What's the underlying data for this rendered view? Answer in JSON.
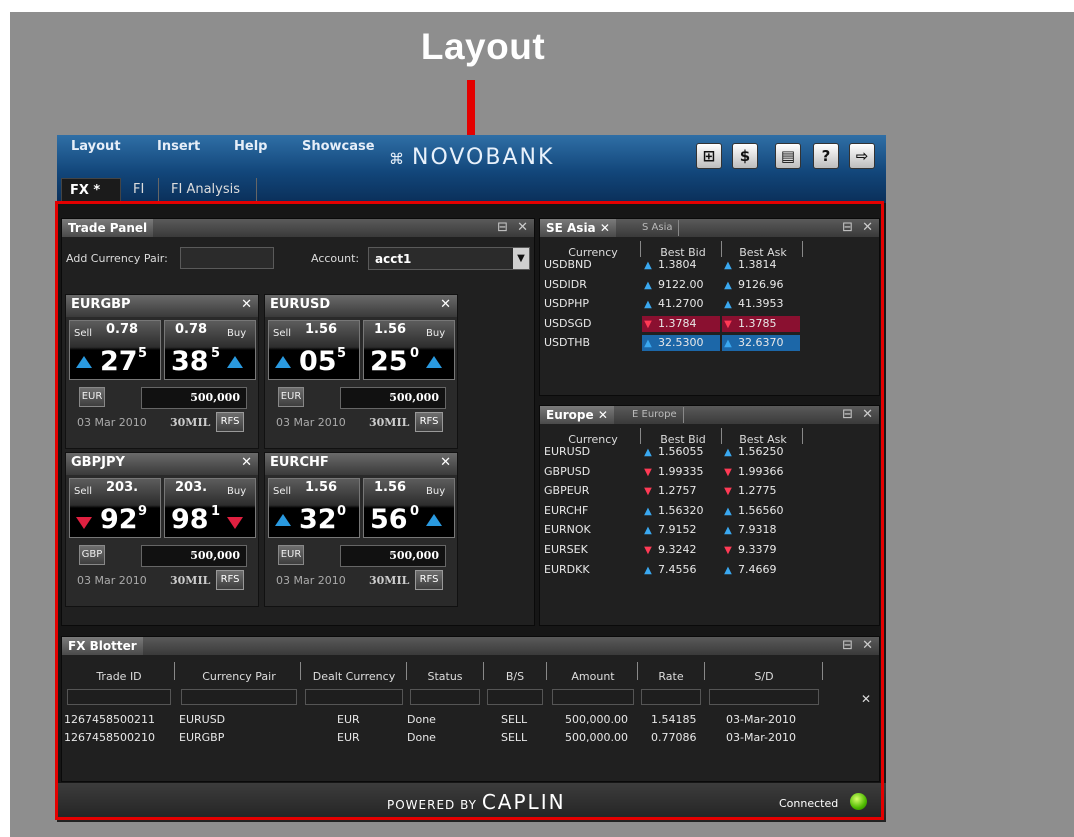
{
  "caption": "Layout",
  "menu": {
    "items": [
      "Layout",
      "Insert",
      "Help",
      "Showcase"
    ]
  },
  "brand": {
    "glyph": "⌘",
    "name": "NOVOBANK"
  },
  "toolbar": {
    "buttons": [
      {
        "icon": "add-panel-icon",
        "glyph": "⊞"
      },
      {
        "icon": "add-currency-icon",
        "glyph": "$"
      },
      {
        "icon": "save-icon",
        "glyph": "▤"
      },
      {
        "icon": "help-icon",
        "glyph": "?"
      },
      {
        "icon": "logout-icon",
        "glyph": "⇨"
      }
    ]
  },
  "tabs": [
    {
      "label": "FX *",
      "active": true
    },
    {
      "label": "FI",
      "active": false
    },
    {
      "label": "FI Analysis",
      "active": false
    }
  ],
  "trade_panel": {
    "title": "Trade Panel",
    "add_pair_label": "Add Currency Pair:",
    "add_pair_value": "",
    "account_label": "Account:",
    "account_value": "acct1",
    "tiles": [
      {
        "pair": "EURGBP",
        "sell_label": "Sell",
        "buy_label": "Buy",
        "sell_big": "0.78",
        "buy_big": "0.78",
        "sell_pips": "27",
        "sell_sup": "5",
        "buy_pips": "38",
        "buy_sup": "5",
        "dir": "up",
        "currency": "EUR",
        "amount": "500,000",
        "date": "03 Mar 2010",
        "tenor": "30MIL",
        "rfs": "RFS"
      },
      {
        "pair": "EURUSD",
        "sell_label": "Sell",
        "buy_label": "Buy",
        "sell_big": "1.56",
        "buy_big": "1.56",
        "sell_pips": "05",
        "sell_sup": "5",
        "buy_pips": "25",
        "buy_sup": "0",
        "dir": "up",
        "currency": "EUR",
        "amount": "500,000",
        "date": "03 Mar 2010",
        "tenor": "30MIL",
        "rfs": "RFS"
      },
      {
        "pair": "GBPJPY",
        "sell_label": "Sell",
        "buy_label": "Buy",
        "sell_big": "203.",
        "buy_big": "203.",
        "sell_pips": "92",
        "sell_sup": "9",
        "buy_pips": "98",
        "buy_sup": "1",
        "dir": "down",
        "currency": "GBP",
        "amount": "500,000",
        "date": "03 Mar 2010",
        "tenor": "30MIL",
        "rfs": "RFS"
      },
      {
        "pair": "EURCHF",
        "sell_label": "Sell",
        "buy_label": "Buy",
        "sell_big": "1.56",
        "buy_big": "1.56",
        "sell_pips": "32",
        "sell_sup": "0",
        "buy_pips": "56",
        "buy_sup": "0",
        "dir": "up",
        "currency": "EUR",
        "amount": "500,000",
        "date": "03 Mar 2010",
        "tenor": "30MIL",
        "rfs": "RFS"
      }
    ]
  },
  "se_asia": {
    "title": "SE Asia",
    "tab2": "S Asia",
    "columns": [
      "Currency",
      "Best Bid",
      "Best Ask"
    ],
    "rows": [
      {
        "ccy": "USDBND",
        "bid": "1.3804",
        "ask": "1.3814",
        "bid_dir": "up",
        "ask_dir": "up",
        "hl": ""
      },
      {
        "ccy": "USDIDR",
        "bid": "9122.00",
        "ask": "9126.96",
        "bid_dir": "up",
        "ask_dir": "up",
        "hl": ""
      },
      {
        "ccy": "USDPHP",
        "bid": "41.2700",
        "ask": "41.3953",
        "bid_dir": "up",
        "ask_dir": "up",
        "hl": ""
      },
      {
        "ccy": "USDSGD",
        "bid": "1.3784",
        "ask": "1.3785",
        "bid_dir": "down",
        "ask_dir": "down",
        "hl": "red"
      },
      {
        "ccy": "USDTHB",
        "bid": "32.5300",
        "ask": "32.6370",
        "bid_dir": "up",
        "ask_dir": "up",
        "hl": "blue"
      }
    ]
  },
  "europe": {
    "title": "Europe",
    "tab2": "E Europe",
    "columns": [
      "Currency",
      "Best Bid",
      "Best Ask"
    ],
    "rows": [
      {
        "ccy": "EURUSD",
        "bid": "1.56055",
        "ask": "1.56250",
        "bid_dir": "up",
        "ask_dir": "up"
      },
      {
        "ccy": "GBPUSD",
        "bid": "1.99335",
        "ask": "1.99366",
        "bid_dir": "down",
        "ask_dir": "down"
      },
      {
        "ccy": "GBPEUR",
        "bid": "1.2757",
        "ask": "1.2775",
        "bid_dir": "down",
        "ask_dir": "down"
      },
      {
        "ccy": "EURCHF",
        "bid": "1.56320",
        "ask": "1.56560",
        "bid_dir": "up",
        "ask_dir": "up"
      },
      {
        "ccy": "EURNOK",
        "bid": "7.9152",
        "ask": "7.9318",
        "bid_dir": "up",
        "ask_dir": "up"
      },
      {
        "ccy": "EURSEK",
        "bid": "9.3242",
        "ask": "9.3379",
        "bid_dir": "down",
        "ask_dir": "down"
      },
      {
        "ccy": "EURDKK",
        "bid": "7.4556",
        "ask": "7.4669",
        "bid_dir": "up",
        "ask_dir": "up"
      }
    ]
  },
  "blotter": {
    "title": "FX Blotter",
    "columns": [
      "Trade ID",
      "Currency Pair",
      "Dealt Currency",
      "Status",
      "B/S",
      "Amount",
      "Rate",
      "S/D"
    ],
    "rows": [
      [
        "1267458500211",
        "EURUSD",
        "EUR",
        "Done",
        "SELL",
        "500,000.00",
        "1.54185",
        "03-Mar-2010"
      ],
      [
        "1267458500210",
        "EURGBP",
        "EUR",
        "Done",
        "SELL",
        "500,000.00",
        "0.77086",
        "03-Mar-2010"
      ]
    ]
  },
  "footer": {
    "powered_label": "POWERED BY",
    "powered_brand": "CAPLIN",
    "status": "Connected"
  },
  "colors": {
    "accent_red": "#e40000",
    "up": "#2a9ae0",
    "down": "#e02040",
    "led": "#4db800"
  }
}
